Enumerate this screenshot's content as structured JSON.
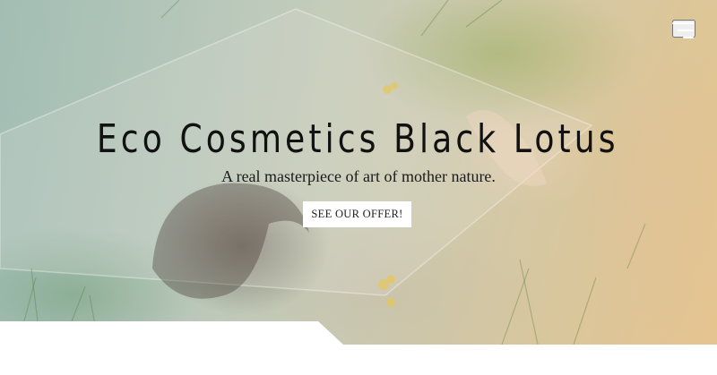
{
  "hero": {
    "title": "Eco Cosmetics Black Lotus",
    "subtitle": "A real masterpiece of art of mother nature.",
    "cta_label": "SEE OUR OFFER!"
  },
  "nav": {
    "menu_icon": "hamburger-menu-icon"
  },
  "colors": {
    "cta_background": "#ffffff",
    "title_text": "#111111",
    "menu_icon": "#ffffff"
  }
}
